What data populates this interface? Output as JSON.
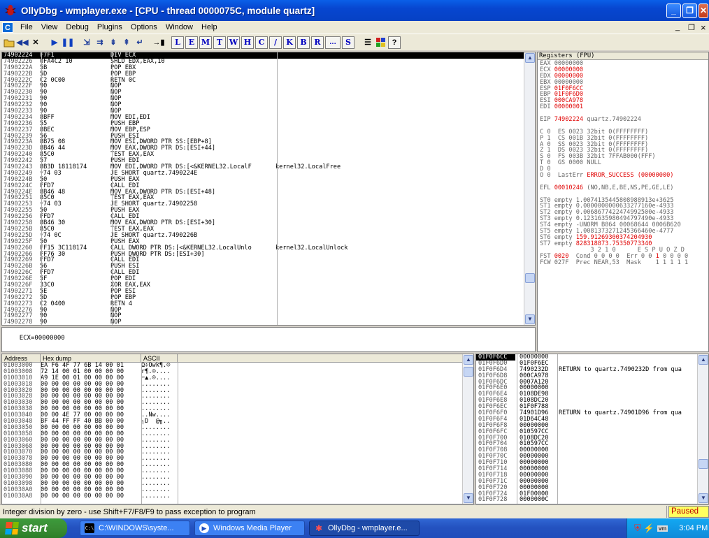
{
  "window": {
    "title": "OllyDbg - wmplayer.exe - [CPU - thread 0000075C, module quartz]",
    "min": "_",
    "restore": "❐",
    "close": "✕",
    "inner_min": "_",
    "inner_restore": "❐",
    "inner_close": "×"
  },
  "menu": {
    "app_icon": "C",
    "items": [
      "File",
      "View",
      "Debug",
      "Plugins",
      "Options",
      "Window",
      "Help"
    ]
  },
  "toolbar": {
    "letters": [
      "L",
      "E",
      "M",
      "T",
      "W",
      "H",
      "C",
      "/",
      "K",
      "B",
      "R",
      "...",
      "S"
    ],
    "help": "?"
  },
  "cpu": {
    "rows": [
      {
        "a": "74902224",
        "h": "F7F1",
        "d": "DIV ECX",
        "c": "",
        "sel": true
      },
      {
        "a": "74902226",
        "h": "0FA4C2 10",
        "d": "SHLD EDX,EAX,10",
        "c": ""
      },
      {
        "a": "7490222A",
        "h": "5B",
        "d": "POP EBX",
        "c": ""
      },
      {
        "a": "7490222B",
        "h": "5D",
        "d": "POP EBP",
        "c": ""
      },
      {
        "a": "7490222C",
        "h": "C2 0C00",
        "d": "RETN 0C",
        "c": ""
      },
      {
        "a": "7490222F",
        "h": "90",
        "d": "NOP",
        "c": ""
      },
      {
        "a": "74902230",
        "h": "90",
        "d": "NOP",
        "c": ""
      },
      {
        "a": "74902231",
        "h": "90",
        "d": "NOP",
        "c": ""
      },
      {
        "a": "74902232",
        "h": "90",
        "d": "NOP",
        "c": ""
      },
      {
        "a": "74902233",
        "h": "90",
        "d": "NOP",
        "c": ""
      },
      {
        "a": "74902234",
        "h": "8BFF",
        "d": "MOV EDI,EDI",
        "c": ""
      },
      {
        "a": "74902236",
        "h": "55",
        "d": "PUSH EBP",
        "c": ""
      },
      {
        "a": "74902237",
        "h": "8BEC",
        "d": "MOV EBP,ESP",
        "c": ""
      },
      {
        "a": "74902239",
        "h": "56",
        "d": "PUSH ESI",
        "c": ""
      },
      {
        "a": "7490223A",
        "h": "8B75 08",
        "d": "MOV ESI,DWORD PTR SS:[EBP+8]",
        "c": ""
      },
      {
        "a": "7490223D",
        "h": "8B46 44",
        "d": "MOV EAX,DWORD PTR DS:[ESI+44]",
        "c": ""
      },
      {
        "a": "74902240",
        "h": "85C0",
        "d": "TEST EAX,EAX",
        "c": ""
      },
      {
        "a": "74902242",
        "h": "57",
        "d": "PUSH EDI",
        "c": ""
      },
      {
        "a": "74902243",
        "h": "8B3D 18118174",
        "d": "MOV EDI,DWORD PTR DS:[<&KERNEL32.LocalF",
        "c": "kernel32.LocalFree"
      },
      {
        "a": "74902249",
        "h": "˅74 03",
        "d": "JE SHORT quartz.7490224E",
        "c": ""
      },
      {
        "a": "7490224B",
        "h": "50",
        "d": "PUSH EAX",
        "c": ""
      },
      {
        "a": "7490224C",
        "h": "FFD7",
        "d": "CALL EDI",
        "c": ""
      },
      {
        "a": "7490224E",
        "h": "8B46 48",
        "d": "MOV EAX,DWORD PTR DS:[ESI+48]",
        "c": ""
      },
      {
        "a": "74902251",
        "h": "85C0",
        "d": "TEST EAX,EAX",
        "c": ""
      },
      {
        "a": "74902253",
        "h": "˅74 03",
        "d": "JE SHORT quartz.74902258",
        "c": ""
      },
      {
        "a": "74902255",
        "h": "50",
        "d": "PUSH EAX",
        "c": ""
      },
      {
        "a": "74902256",
        "h": "FFD7",
        "d": "CALL EDI",
        "c": ""
      },
      {
        "a": "74902258",
        "h": "8B46 30",
        "d": "MOV EAX,DWORD PTR DS:[ESI+30]",
        "c": ""
      },
      {
        "a": "7490225B",
        "h": "85C0",
        "d": "TEST EAX,EAX",
        "c": ""
      },
      {
        "a": "7490225D",
        "h": "˅74 0C",
        "d": "JE SHORT quartz.7490226B",
        "c": ""
      },
      {
        "a": "7490225F",
        "h": "50",
        "d": "PUSH EAX",
        "c": ""
      },
      {
        "a": "74902260",
        "h": "FF15 3C118174",
        "d": "CALL DWORD PTR DS:[<&KERNEL32.LocalUnlo",
        "c": "kernel32.LocalUnlock"
      },
      {
        "a": "74902266",
        "h": "FF76 30",
        "d": "PUSH DWORD PTR DS:[ESI+30]",
        "c": ""
      },
      {
        "a": "74902269",
        "h": "FFD7",
        "d": "CALL EDI",
        "c": ""
      },
      {
        "a": "7490226B",
        "h": "56",
        "d": "PUSH ESI",
        "c": ""
      },
      {
        "a": "7490226C",
        "h": "FFD7",
        "d": "CALL EDI",
        "c": ""
      },
      {
        "a": "7490226E",
        "h": "5F",
        "d": "POP EDI",
        "c": ""
      },
      {
        "a": "7490226F",
        "h": "33C0",
        "d": "XOR EAX,EAX",
        "c": ""
      },
      {
        "a": "74902271",
        "h": "5E",
        "d": "POP ESI",
        "c": ""
      },
      {
        "a": "74902272",
        "h": "5D",
        "d": "POP EBP",
        "c": ""
      },
      {
        "a": "74902273",
        "h": "C2 0400",
        "d": "RETN 4",
        "c": ""
      },
      {
        "a": "74902276",
        "h": "90",
        "d": "NOP",
        "c": ""
      },
      {
        "a": "74902277",
        "h": "90",
        "d": "NOP",
        "c": ""
      },
      {
        "a": "74902278",
        "h": "90",
        "d": "NOP",
        "c": ""
      }
    ],
    "info": "ECX=00000000"
  },
  "registers": {
    "header": "Registers (FPU)",
    "lines": [
      [
        {
          "t": "EAX 00000000",
          "c": "gray"
        }
      ],
      [
        {
          "t": "ECX ",
          "c": "gray"
        },
        {
          "t": "00000000",
          "c": "red"
        }
      ],
      [
        {
          "t": "EDX ",
          "c": "gray"
        },
        {
          "t": "00000000",
          "c": "red"
        }
      ],
      [
        {
          "t": "EBX 00000000",
          "c": "gray"
        }
      ],
      [
        {
          "t": "ESP ",
          "c": "gray"
        },
        {
          "t": "01F0F6CC",
          "c": "red"
        }
      ],
      [
        {
          "t": "EBP ",
          "c": "gray"
        },
        {
          "t": "01F0F6D0",
          "c": "red"
        }
      ],
      [
        {
          "t": "ESI ",
          "c": "gray"
        },
        {
          "t": "000CA978",
          "c": "red"
        }
      ],
      [
        {
          "t": "EDI ",
          "c": "gray"
        },
        {
          "t": "00000001",
          "c": "red"
        }
      ],
      [
        {
          "t": "",
          "c": "gray"
        }
      ],
      [
        {
          "t": "EIP ",
          "c": "gray"
        },
        {
          "t": "74902224",
          "c": "red"
        },
        {
          "t": " quartz.74902224",
          "c": "gray"
        }
      ],
      [
        {
          "t": "",
          "c": "gray"
        }
      ],
      [
        {
          "t": "C 0  ES 0023 32bit 0(FFFFFFFF)",
          "c": "gray"
        }
      ],
      [
        {
          "t": "P 1  CS 001B 32bit 0(FFFFFFFF)",
          "c": "gray"
        }
      ],
      [
        {
          "t": "A 0  SS 0023 32bit 0(FFFFFFFF)",
          "c": "gray"
        }
      ],
      [
        {
          "t": "Z 1  DS 0023 32bit 0(FFFFFFFF)",
          "c": "gray"
        }
      ],
      [
        {
          "t": "S 0  FS 003B 32bit 7FFAB000(FFF)",
          "c": "gray"
        }
      ],
      [
        {
          "t": "T 0  GS 0000 NULL",
          "c": "gray"
        }
      ],
      [
        {
          "t": "D 0",
          "c": "gray"
        }
      ],
      [
        {
          "t": "O 0  LastErr ",
          "c": "gray"
        },
        {
          "t": "ERROR_SUCCESS (00000000)",
          "c": "red"
        }
      ],
      [
        {
          "t": "",
          "c": "gray"
        }
      ],
      [
        {
          "t": "EFL ",
          "c": "gray"
        },
        {
          "t": "00010246",
          "c": "red"
        },
        {
          "t": " (NO,NB,E,BE,NS,PE,GE,LE)",
          "c": "gray"
        }
      ],
      [
        {
          "t": "",
          "c": "gray"
        }
      ],
      [
        {
          "t": "ST0 empty 1.0074135445808988913e+3625",
          "c": "gray"
        }
      ],
      [
        {
          "t": "ST1 empty 0.0000000000633277160e-4933",
          "c": "gray"
        }
      ],
      [
        {
          "t": "ST2 empty 0.0068677422474992500e-4933",
          "c": "gray"
        }
      ],
      [
        {
          "t": "ST3 empty 0.1231635980494797490e-4933",
          "c": "gray"
        }
      ],
      [
        {
          "t": "ST4 empty -UNORM B864 00068644 0006B620",
          "c": "gray"
        }
      ],
      [
        {
          "t": "ST5 empty 1.0081373271245366460e-4777",
          "c": "gray"
        }
      ],
      [
        {
          "t": "ST6 empty ",
          "c": "gray"
        },
        {
          "t": "159.91269300374204930",
          "c": "red"
        }
      ],
      [
        {
          "t": "ST7 empty ",
          "c": "gray"
        },
        {
          "t": "828318873.75350773340",
          "c": "red"
        }
      ],
      [
        {
          "t": "              3 2 1 0      E S P U O Z D",
          "c": "gray"
        }
      ],
      [
        {
          "t": "FST ",
          "c": "gray"
        },
        {
          "t": "0020",
          "c": "red"
        },
        {
          "t": "  Cond 0 0 0 0  Err 0 0 ",
          "c": "gray"
        },
        {
          "t": "1",
          "c": "red"
        },
        {
          "t": " 0 0 0 0",
          "c": "gray"
        }
      ],
      [
        {
          "t": "FCW 027F  Prec NEAR,53  Mask    1 1 1 1 1",
          "c": "gray"
        }
      ]
    ]
  },
  "dump": {
    "headers": [
      "Address",
      "Hex dump",
      "ASCII"
    ],
    "rows": [
      {
        "a": "01003000",
        "h": "EA F6 4F 77 6B 14 00 01",
        "s": "Ω÷Owk¶.☺"
      },
      {
        "a": "01003008",
        "h": "72 14 00 01 00 00 00 00",
        "s": "r¶.☺...."
      },
      {
        "a": "01003010",
        "h": "A9 1E 00 01 00 00 00 00",
        "s": "⌐▲.☺...."
      },
      {
        "a": "01003018",
        "h": "00 00 00 00 00 00 00 00",
        "s": "........"
      },
      {
        "a": "01003020",
        "h": "00 00 00 00 00 00 00 00",
        "s": "........"
      },
      {
        "a": "01003028",
        "h": "00 00 00 00 00 00 00 00",
        "s": "........"
      },
      {
        "a": "01003030",
        "h": "00 00 00 00 00 00 00 00",
        "s": "........"
      },
      {
        "a": "01003038",
        "h": "00 00 00 00 00 00 00 00",
        "s": "........"
      },
      {
        "a": "01003040",
        "h": "00 00 4E 77 00 00 00 00",
        "s": "..Nw...."
      },
      {
        "a": "01003048",
        "h": "BF 44 FF FF 40 BB 00 00",
        "s": "┐D  @╗.."
      },
      {
        "a": "01003050",
        "h": "00 00 00 00 00 00 00 00",
        "s": "........"
      },
      {
        "a": "01003058",
        "h": "00 00 00 00 00 00 00 00",
        "s": "........"
      },
      {
        "a": "01003060",
        "h": "00 00 00 00 00 00 00 00",
        "s": "........"
      },
      {
        "a": "01003068",
        "h": "00 00 00 00 00 00 00 00",
        "s": "........"
      },
      {
        "a": "01003070",
        "h": "00 00 00 00 00 00 00 00",
        "s": "........"
      },
      {
        "a": "01003078",
        "h": "00 00 00 00 00 00 00 00",
        "s": "........"
      },
      {
        "a": "01003080",
        "h": "00 00 00 00 00 00 00 00",
        "s": "........"
      },
      {
        "a": "01003088",
        "h": "00 00 00 00 00 00 00 00",
        "s": "........"
      },
      {
        "a": "01003090",
        "h": "00 00 00 00 00 00 00 00",
        "s": "........"
      },
      {
        "a": "01003098",
        "h": "00 00 00 00 00 00 00 00",
        "s": "........"
      },
      {
        "a": "010030A0",
        "h": "00 00 00 00 00 00 00 00",
        "s": "........"
      },
      {
        "a": "010030A8",
        "h": "00 00 00 00 00 00 00 00",
        "s": "........"
      }
    ]
  },
  "stack": {
    "rows": [
      {
        "a": "01F0F6CC",
        "v": "00000000",
        "c": "",
        "top": true
      },
      {
        "a": "01F0F6D0",
        "v": "01F0F6EC",
        "c": ""
      },
      {
        "a": "01F0F6D4",
        "v": "7490232D",
        "c": "RETURN to quartz.7490232D from qua"
      },
      {
        "a": "01F0F6D8",
        "v": "000CA978",
        "c": ""
      },
      {
        "a": "01F0F6DC",
        "v": "0007A120",
        "c": ""
      },
      {
        "a": "01F0F6E0",
        "v": "00000000",
        "c": ""
      },
      {
        "a": "01F0F6E4",
        "v": "0108DE98",
        "c": ""
      },
      {
        "a": "01F0F6E8",
        "v": "0108DC20",
        "c": ""
      },
      {
        "a": "01F0F6EC",
        "v": "01F0F788",
        "c": ""
      },
      {
        "a": "01F0F6F0",
        "v": "74901D96",
        "c": "RETURN to quartz.74901D96 from qua"
      },
      {
        "a": "01F0F6F4",
        "v": "01D64C48",
        "c": ""
      },
      {
        "a": "01F0F6F8",
        "v": "00000000",
        "c": ""
      },
      {
        "a": "01F0F6FC",
        "v": "010597CC",
        "c": ""
      },
      {
        "a": "01F0F700",
        "v": "0108DC20",
        "c": ""
      },
      {
        "a": "01F0F704",
        "v": "010597CC",
        "c": ""
      },
      {
        "a": "01F0F708",
        "v": "00000000",
        "c": ""
      },
      {
        "a": "01F0F70C",
        "v": "00000000",
        "c": ""
      },
      {
        "a": "01F0F710",
        "v": "00000000",
        "c": ""
      },
      {
        "a": "01F0F714",
        "v": "00000000",
        "c": ""
      },
      {
        "a": "01F0F718",
        "v": "00000000",
        "c": ""
      },
      {
        "a": "01F0F71C",
        "v": "00000000",
        "c": ""
      },
      {
        "a": "01F0F720",
        "v": "00000000",
        "c": ""
      },
      {
        "a": "01F0F724",
        "v": "01F00000",
        "c": ""
      },
      {
        "a": "01F0F728",
        "v": "0000000C",
        "c": ""
      }
    ]
  },
  "status": {
    "text": "Integer division by zero - use Shift+F7/F8/F9 to pass exception to program",
    "state": "Paused"
  },
  "taskbar": {
    "start": "start",
    "tasks": [
      {
        "label": "C:\\WINDOWS\\syste...",
        "icon": "C:\\"
      },
      {
        "label": "Windows Media Player",
        "icon": "▶"
      },
      {
        "label": "OllyDbg - wmplayer.e...",
        "icon": "✱",
        "active": true
      }
    ],
    "clock": "3:04 PM"
  },
  "colors": {
    "titlebar": "#0746d0",
    "taskbar": "#2452c0",
    "start": "#3a8d34",
    "paused_bg": "#ffff60",
    "paused_fg": "#c00000",
    "register_changed": "#e00000"
  }
}
